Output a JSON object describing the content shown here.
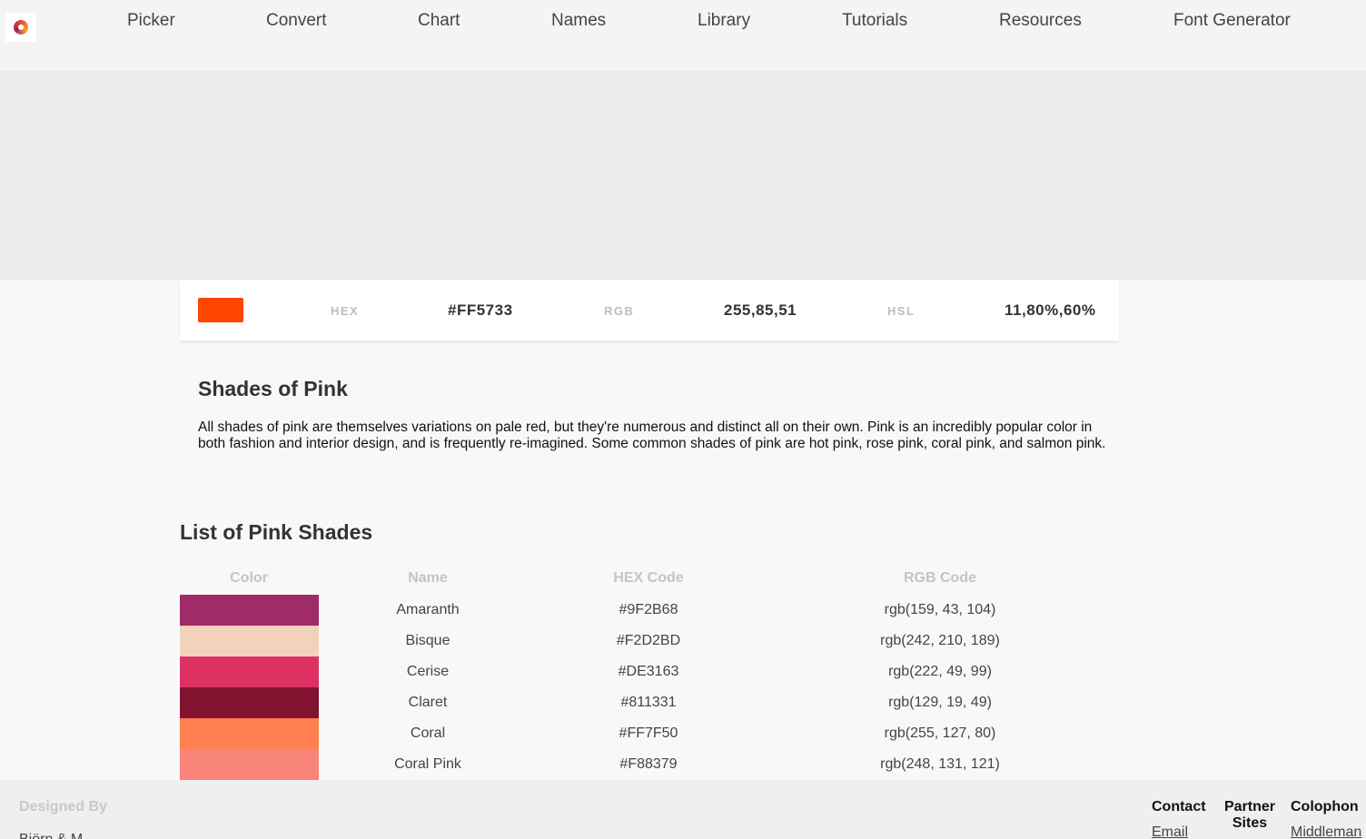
{
  "nav": {
    "items": [
      "Picker",
      "Convert",
      "Chart",
      "Names",
      "Library",
      "Tutorials",
      "Resources",
      "Font Generator"
    ]
  },
  "color_card": {
    "swatch_color": "#FF4500",
    "hex_label": "HEX",
    "hex_value": "#FF5733",
    "rgb_label": "RGB",
    "rgb_value": "255,85,51",
    "hsl_label": "HSL",
    "hsl_value": "11,80%,60%"
  },
  "intro": {
    "title": "Shades of Pink",
    "text": "All shades of pink are themselves variations on pale red, but they're numerous and distinct all on their own. Pink is an incredibly popular color in both fashion and interior design, and is frequently re-imagined. Some common shades of pink are hot pink, rose pink, coral pink, and salmon pink."
  },
  "shades": {
    "title": "List of Pink Shades",
    "headers": {
      "color": "Color",
      "name": "Name",
      "hex": "HEX Code",
      "rgb": "RGB Code"
    },
    "rows": [
      {
        "name": "Amaranth",
        "hex": "#9F2B68",
        "rgb": "rgb(159, 43, 104)",
        "swatch": "#9F2B68"
      },
      {
        "name": "Bisque",
        "hex": "#F2D2BD",
        "rgb": "rgb(242, 210, 189)",
        "swatch": "#F2D2BD"
      },
      {
        "name": "Cerise",
        "hex": "#DE3163",
        "rgb": "rgb(222, 49, 99)",
        "swatch": "#DE3163"
      },
      {
        "name": "Claret",
        "hex": "#811331",
        "rgb": "rgb(129, 19, 49)",
        "swatch": "#811331"
      },
      {
        "name": "Coral",
        "hex": "#FF7F50",
        "rgb": "rgb(255, 127, 80)",
        "swatch": "#FF7F50"
      },
      {
        "name": "Coral Pink",
        "hex": "#F88379",
        "rgb": "rgb(248, 131, 121)",
        "swatch": "#F88379"
      }
    ]
  },
  "footer": {
    "designed_by": "Designed By",
    "designer": "Björn & M...",
    "contact": "Contact",
    "contact_link": "Email",
    "partner": "Partner Sites",
    "colophon": "Colophon",
    "colophon_link": "Middleman"
  }
}
